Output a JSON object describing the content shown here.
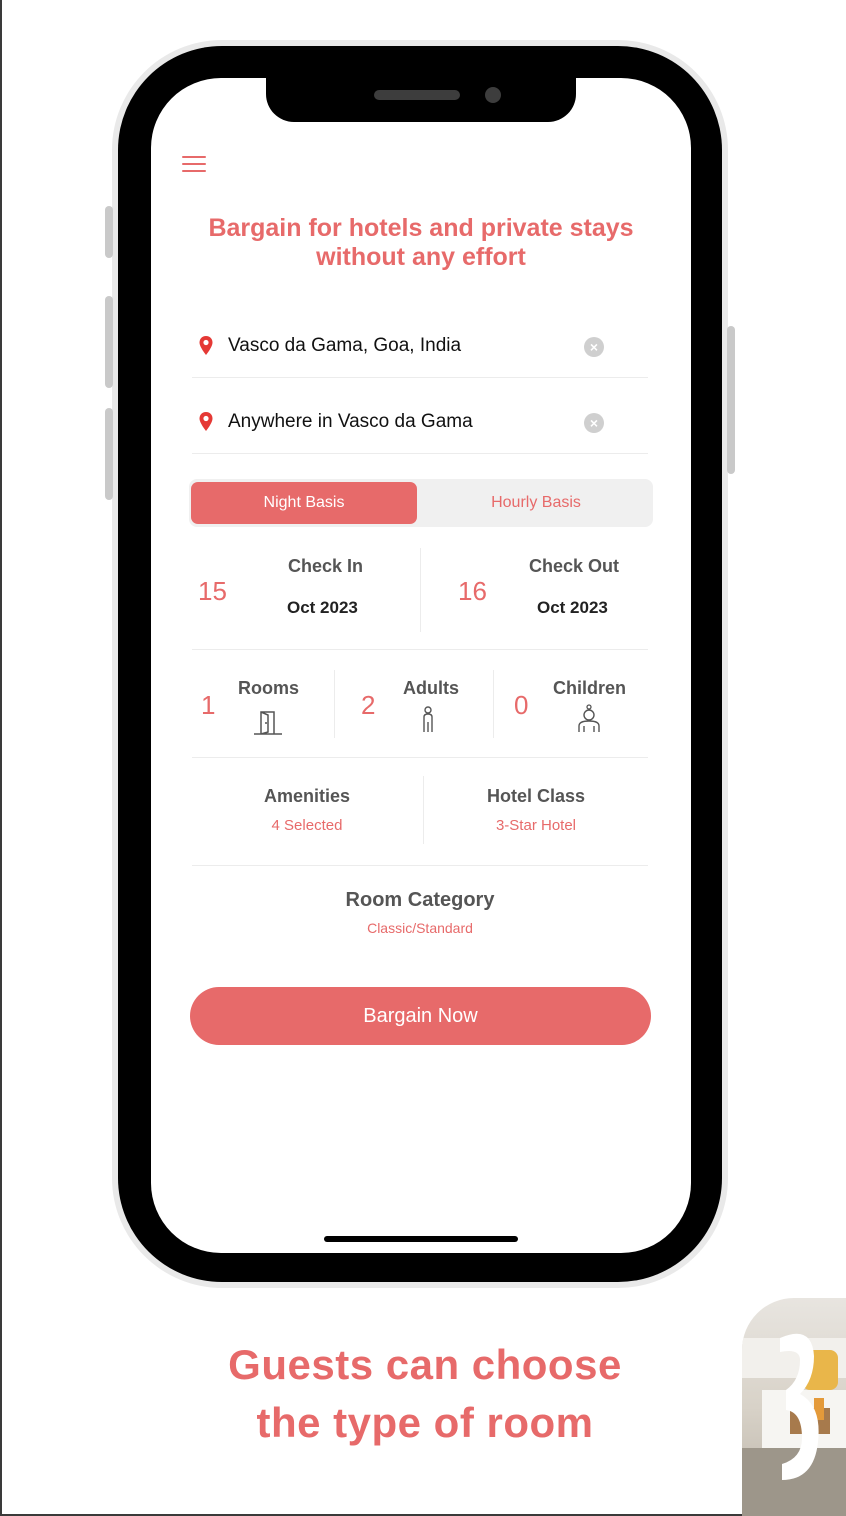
{
  "colors": {
    "accent": "#e76a6a",
    "text_dark": "#111111",
    "divider": "#ececec"
  },
  "menu": {
    "icon": "hamburger-menu-icon"
  },
  "headline": "Bargain for hotels and private stays without any effort",
  "location": {
    "primary": "Vasco da Gama, Goa, India",
    "secondary": "Anywhere in Vasco da Gama"
  },
  "basis_toggle": {
    "active": "Night Basis",
    "inactive": "Hourly Basis"
  },
  "dates": {
    "check_in": {
      "day": "15",
      "label": "Check In",
      "month": "Oct 2023"
    },
    "check_out": {
      "day": "16",
      "label": "Check Out",
      "month": "Oct 2023"
    }
  },
  "occupancy": {
    "rooms": {
      "count": "1",
      "label": "Rooms",
      "icon": "door-icon"
    },
    "adults": {
      "count": "2",
      "label": "Adults",
      "icon": "adult-person-icon"
    },
    "children": {
      "count": "0",
      "label": "Children",
      "icon": "child-person-icon"
    }
  },
  "filters": {
    "amenities": {
      "label": "Amenities",
      "value": "4 Selected"
    },
    "hotel_class": {
      "label": "Hotel Class",
      "value": "3-Star Hotel"
    }
  },
  "room_category": {
    "label": "Room Category",
    "value": "Classic/Standard"
  },
  "cta": "Bargain Now",
  "caption": {
    "line1": "Guests can choose",
    "line2": "the type of room"
  }
}
